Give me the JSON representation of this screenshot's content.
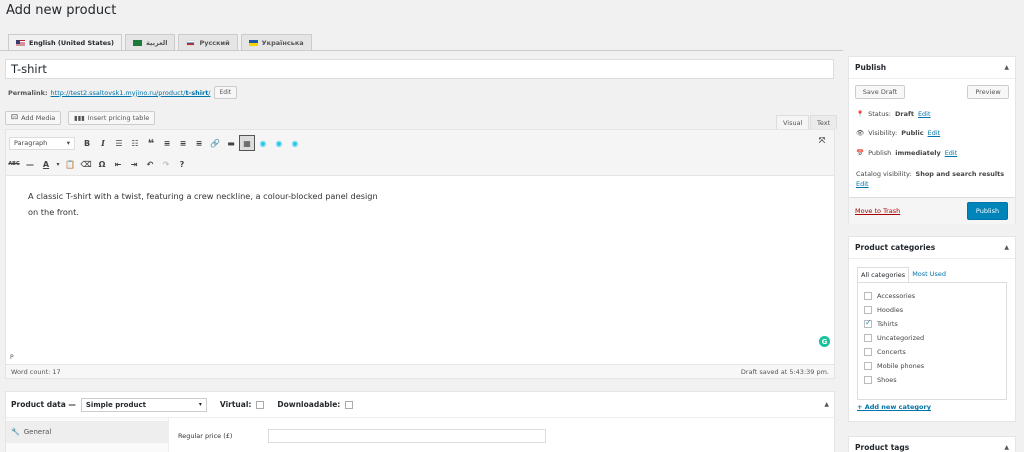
{
  "page": {
    "title": "Add new product"
  },
  "languages": [
    {
      "label": "English (United States)",
      "flag": "us",
      "active": true
    },
    {
      "label": "العربية",
      "flag": "ar",
      "active": false
    },
    {
      "label": "Русский",
      "flag": "ru",
      "active": false
    },
    {
      "label": "Українська",
      "flag": "ua",
      "active": false
    }
  ],
  "post": {
    "title": "T-shirt",
    "permalink_label": "Permalink:",
    "permalink_base": "http://test2.ssaltovsk1.myjino.ru/product/",
    "permalink_slug": "t-shirt",
    "permalink_end": "/",
    "edit_label": "Edit"
  },
  "media": {
    "add_media": "Add Media",
    "insert_pricing": "Insert pricing table"
  },
  "editor": {
    "tab_visual": "Visual",
    "tab_text": "Text",
    "paragraph": "Paragraph",
    "content": "A classic T-shirt with a twist, featuring a crew neckline, a colour-blocked panel design on the front.",
    "path": "P",
    "word_count": "Word count: 17",
    "draft_saved": "Draft saved at 5:43:39 pm."
  },
  "product_data": {
    "label": "Product data —",
    "type": "Simple product",
    "virtual": "Virtual:",
    "downloadable": "Downloadable:",
    "general": "General",
    "regular_price": "Regular price (£)"
  },
  "publish": {
    "title": "Publish",
    "save_draft": "Save Draft",
    "preview": "Preview",
    "status_label": "Status:",
    "status_value": "Draft",
    "visibility_label": "Visibility:",
    "visibility_value": "Public",
    "publish_label": "Publish",
    "publish_value": "immediately",
    "edit": "Edit",
    "catalog_label": "Catalog visibility:",
    "catalog_value": "Shop and search results",
    "move_to_trash": "Move to Trash",
    "publish_button": "Publish"
  },
  "categories": {
    "title": "Product categories",
    "tab_all": "All categories",
    "tab_most_used": "Most Used",
    "items": [
      {
        "label": "Accessories",
        "checked": false
      },
      {
        "label": "Hoodies",
        "checked": false
      },
      {
        "label": "Tshirts",
        "checked": true
      },
      {
        "label": "Uncategorized",
        "checked": false
      },
      {
        "label": "Concerts",
        "checked": false
      },
      {
        "label": "Mobile phones",
        "checked": false
      },
      {
        "label": "Shoes",
        "checked": false
      }
    ],
    "add_new": "+ Add new category"
  },
  "tags": {
    "title": "Product tags"
  },
  "colors": {
    "primary": "#0085ba",
    "link": "#0073aa",
    "trash": "#a00",
    "grammarly": "#15c39a"
  }
}
